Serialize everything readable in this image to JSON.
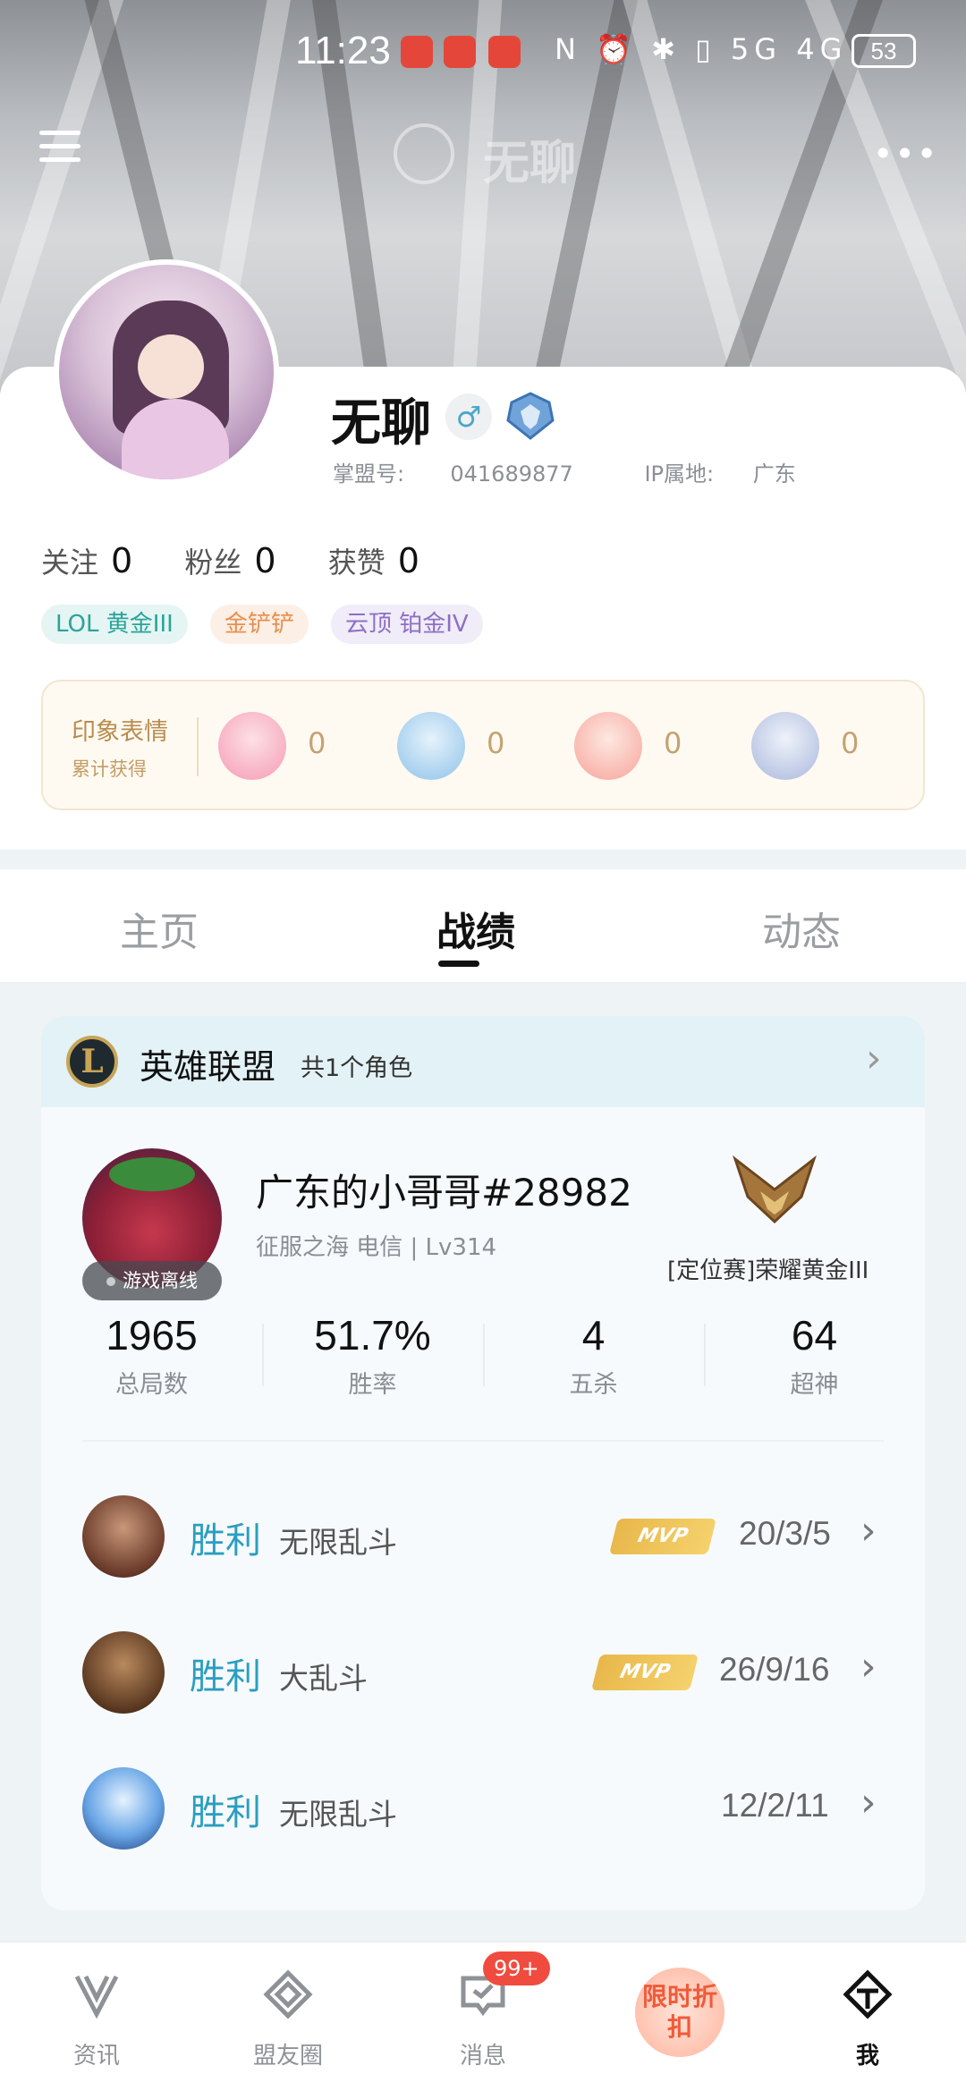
{
  "status_bar": {
    "time": "11:23",
    "network_icons": "N ⏰ ✱ ▯ 5G 4G",
    "battery": "53"
  },
  "header": {
    "title": "无聊",
    "more_label": "•••"
  },
  "profile": {
    "name": "无聊",
    "gender_symbol": "♂",
    "id_label": "掌盟号:",
    "id_value": "041689877",
    "ip_label": "IP属地:",
    "ip_value": "广东",
    "stats": [
      {
        "label": "关注",
        "value": "0"
      },
      {
        "label": "粉丝",
        "value": "0"
      },
      {
        "label": "获赞",
        "value": "0"
      }
    ],
    "tags": [
      "LOL 黄金III",
      "金铲铲",
      "云顶 铂金IV"
    ],
    "emotes": {
      "title": "印象表情",
      "subtitle": "累计获得",
      "counts": [
        "0",
        "0",
        "0",
        "0"
      ]
    }
  },
  "tabs": [
    "主页",
    "战绩",
    "动态"
  ],
  "active_tab": "战绩",
  "game": {
    "title": "英雄联盟",
    "subtitle": "共1个角色",
    "logo_letter": "L",
    "account_name": "广东的小哥哥#28982",
    "server": "征服之海 电信 | Lv314",
    "status": "游戏离线",
    "rank": "[定位赛]荣耀黄金III",
    "stats": [
      {
        "value": "1965",
        "label": "总局数"
      },
      {
        "value": "51.7%",
        "label": "胜率"
      },
      {
        "value": "4",
        "label": "五杀"
      },
      {
        "value": "64",
        "label": "超神"
      }
    ],
    "matches": [
      {
        "result": "胜利",
        "mode": "无限乱斗",
        "mvp": "MVP",
        "kda": "20/3/5"
      },
      {
        "result": "胜利",
        "mode": "大乱斗",
        "mvp": "MVP",
        "kda": "26/9/16"
      },
      {
        "result": "胜利",
        "mode": "无限乱斗",
        "mvp": "",
        "kda": "12/2/11"
      }
    ]
  },
  "bottom_nav": {
    "items": [
      "资讯",
      "盟友圈",
      "消息",
      "我"
    ],
    "badge": "99+",
    "promo": "限时折扣"
  },
  "colors": {
    "accent": "#2a9ec0",
    "tag_teal": "#2aa39a",
    "tag_orange": "#e88f4d",
    "tag_purple": "#8e6fc4",
    "badge_red": "#f04b3f"
  }
}
